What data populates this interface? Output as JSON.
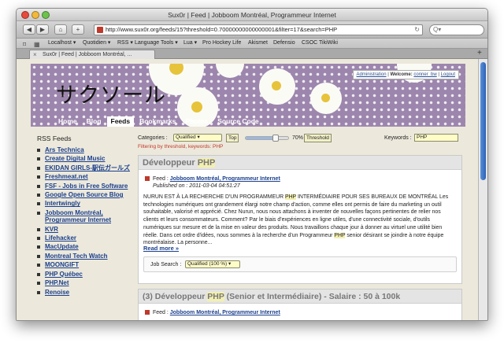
{
  "window": {
    "title": "Sux0r | Feed | Jobboom Montréal, Programmeur Internet"
  },
  "toolbar": {
    "back": "◀",
    "forward": "▶",
    "home": "⌂",
    "add": "+",
    "url": "http://www.sux0r.org/feeds/15?threshold=0.70000000000000001&filter=17&search=PHP",
    "search_placeholder": "Q▾"
  },
  "bookmarks": [
    "Localhost ▾",
    "Quotidien ▾",
    "RSS ▾",
    "Language Tools ▾",
    "Lua ▾",
    "Pro Hockey Life",
    "Akismet",
    "Defensio",
    "CSOC TikiWiki"
  ],
  "tab": {
    "label": "Sux0r | Feed | Jobboom Montréal, ..."
  },
  "site": {
    "title": "サクソール",
    "userbox": {
      "admin": "Administration",
      "welcome": "Welcome:",
      "user": "conner_bw",
      "logout": "Logout"
    },
    "nav": [
      "Home",
      "Blog",
      "Feeds",
      "Bookmarks",
      "Photos",
      "Source Code"
    ],
    "active_nav": "Feeds"
  },
  "sidebar": {
    "title": "RSS Feeds",
    "feeds": [
      "Ars Technica",
      "Create Digital Music",
      "EKIDAN GIRLS-駅伝ガールズ",
      "Freshmeat.net",
      "FSF - Jobs in Free Software",
      "Google Open Source Blog",
      "Intertwingly",
      "Jobboom Montréal, Programmeur Internet",
      "KVR",
      "Lifehacker",
      "MacUpdate",
      "Montreal Tech Watch",
      "MOONGIFT",
      "PHP Québec",
      "PHP.Net",
      "Renoise"
    ]
  },
  "filter": {
    "categories_label": "Categories :",
    "categories_value": "Qualified ▾",
    "top_button": "Top",
    "threshold_value": 0.7,
    "threshold_label": "70%",
    "threshold_button": "Threshold",
    "keywords_label": "Keywords :",
    "keywords_value": "PHP",
    "message": "Filtering by threshold, keywords: PHP"
  },
  "article1": {
    "title_pre": "Développeur ",
    "title_hl": "PHP",
    "title_post": "",
    "feed_label": "Feed :",
    "feed_name": "Jobboom Montréal, Programmeur Internet",
    "published": "Published on : 2011-03-04 04:51:27",
    "body": [
      {
        "t": "NURUN EST À LA RECHERCHE D'UN PROGRAMMEUR "
      },
      {
        "h": "PHP"
      },
      {
        "t": " INTERMÉDIAIRE POUR SES BUREAUX DE MONTRÉAL Les technologies numériques ont grandement élargi notre champ d'action, comme elles ont permis de faire du marketing un outil souhaitable, valorisé et apprécié. Chez Nurun, nous nous attachons à inventer de nouvelles façons pertinentes de relier nos clients et leurs consommateurs. Comment? Par le biais d'expériences en ligne utiles, d'une connectivité sociale, d'outils numériques sur mesure et de la mise en valeur des produits. Nous travaillons chaque jour à donner au virtuel une utilité bien réelle. Dans cet ordre d'idées, nous sommes à la recherche d'un Programmeur "
      },
      {
        "h": "PHP"
      },
      {
        "t": " senior désirant se joindre à notre équipe montréalaise. La personne..."
      }
    ],
    "read_more": "Read more »",
    "job_search_label": "Job Search :",
    "job_search_value": "Qualified (100 %) ▾"
  },
  "article2": {
    "title_pre": "(3) Développeur ",
    "title_hl": "PHP",
    "title_post": " (Senior et Intermédiaire) - Salaire : 50 à 100k",
    "feed_label": "Feed :",
    "feed_name": "Jobboom Montréal, Programmeur Internet"
  }
}
